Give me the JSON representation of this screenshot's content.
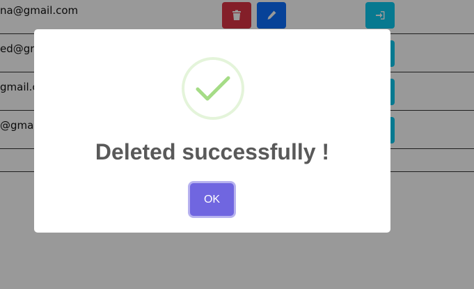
{
  "table": {
    "rows": [
      {
        "email": "na@gmail.com"
      },
      {
        "email": "ed@gr"
      },
      {
        "email": "gmail.c"
      },
      {
        "email": "@gmai"
      }
    ],
    "actions": {
      "delete_icon": "trash-icon",
      "edit_icon": "pencil-icon",
      "login_icon": "sign-in-icon"
    }
  },
  "dialog": {
    "icon": "checkmark-icon",
    "title": "Deleted successfully !",
    "confirm_label": "OK"
  },
  "colors": {
    "delete": "#dc3545",
    "edit": "#0d6efd",
    "login": "#0dcaf0",
    "confirm": "#7066e0",
    "success": "#a5dc86"
  }
}
